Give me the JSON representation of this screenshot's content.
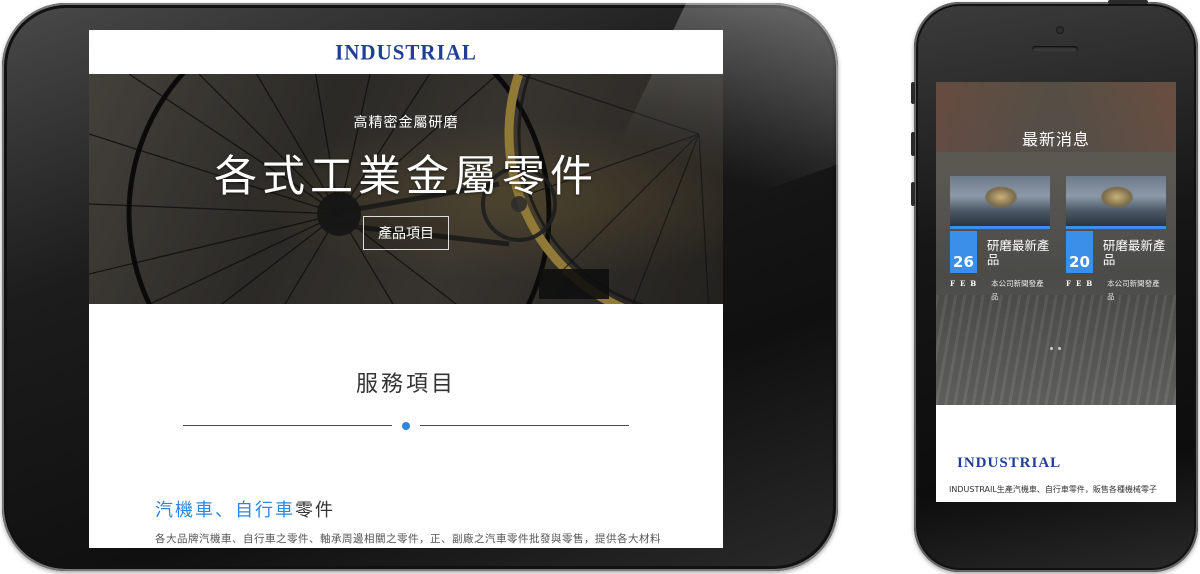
{
  "tablet": {
    "logo": "INDUSTRIAL",
    "hero": {
      "subtitle": "高精密金屬研磨",
      "title": "各式工業金屬零件",
      "button": "產品項目"
    },
    "services": {
      "heading": "服務項目",
      "item_title_highlight": "汽機車、自行車",
      "item_title_rest": "零件",
      "item_text": "各大品牌汽機車、自行車之零件、軸承周邊相關之零件，正、副廠之汽車零件批發與零售，提供各大材料行與修理廠所須之零件。"
    }
  },
  "phone": {
    "news": {
      "heading": "最新消息",
      "cards": [
        {
          "day": "26",
          "month": "FEB",
          "title": "研磨最新產品",
          "desc": "本公司新聞發產品"
        },
        {
          "day": "20",
          "month": "FEB",
          "title": "研磨最新產品",
          "desc": "本公司新聞發產品"
        }
      ]
    },
    "footer": {
      "logo": "INDUSTRIAL",
      "text": "INDUSTRAIL生產汽機車、自行車零件，販售各種機械零子"
    }
  },
  "colors": {
    "accent_blue": "#2e86de",
    "logo_blue": "#1e3f95",
    "date_blue": "#3b8fe8"
  }
}
